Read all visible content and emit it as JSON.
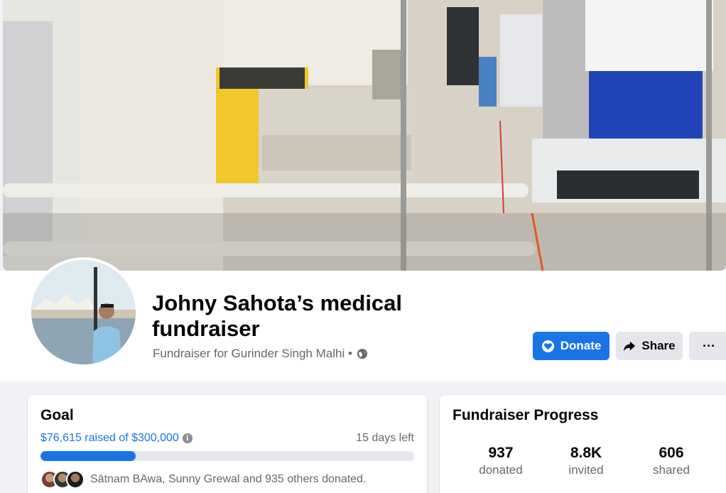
{
  "fundraiser": {
    "title": "Johny Sahota’s medical fundraiser",
    "subtitle": "Fundraiser for Gurinder Singh Malhi •",
    "privacy_icon": "globe-icon"
  },
  "actions": {
    "donate_label": "Donate",
    "share_label": "Share",
    "more_label": "···"
  },
  "goal": {
    "heading": "Goal",
    "raised_text": "$76,615 raised of $300,000",
    "days_left": "15 days left",
    "progress_fraction": 0.2554,
    "donors_text": "Sātnam BAwa, Sunny Grewal and 935 others donated."
  },
  "progress": {
    "heading": "Fundraiser Progress",
    "stats": [
      {
        "number": "937",
        "label": "donated"
      },
      {
        "number": "8.8K",
        "label": "invited"
      },
      {
        "number": "606",
        "label": "shared"
      }
    ]
  },
  "colors": {
    "accent": "#1b74e4",
    "secondary_button": "#e4e6eb",
    "page_background": "#f0f2f5"
  }
}
